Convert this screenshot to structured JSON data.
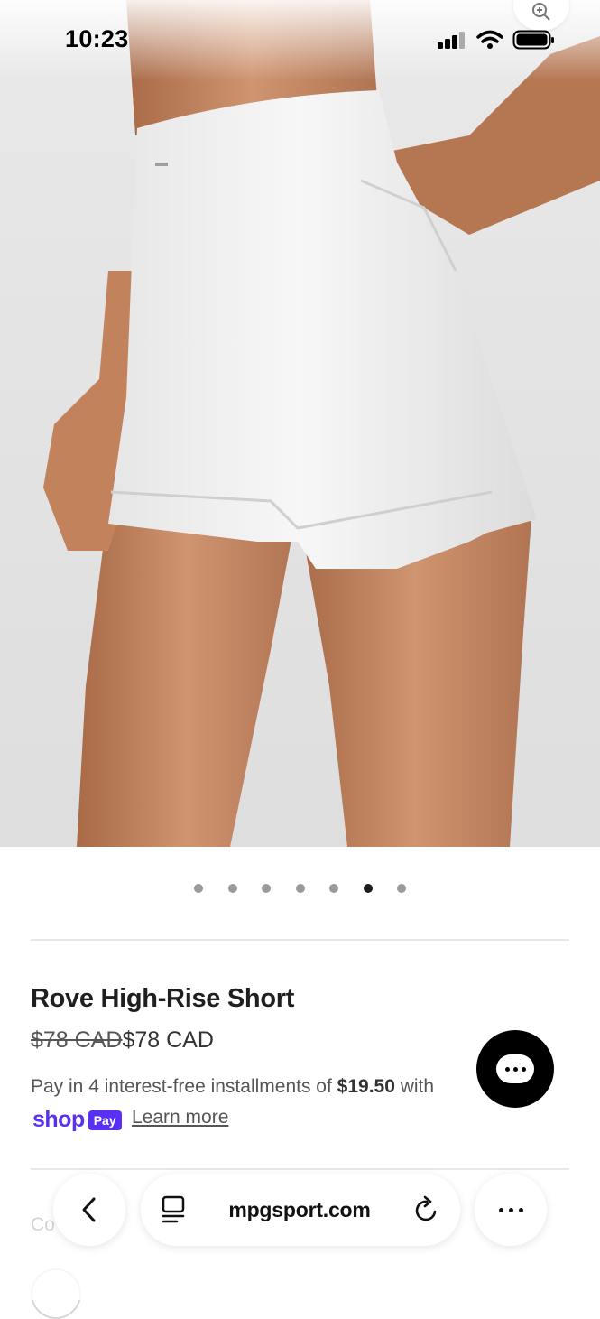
{
  "status_bar": {
    "time": "10:23"
  },
  "carousel": {
    "total": 7,
    "active_index": 5
  },
  "product": {
    "title": "Rove High-Rise Short",
    "compare_price": "$78 CAD",
    "price": "$78 CAD",
    "installments_prefix": "Pay in 4 interest-free installments of ",
    "installments_amount": "$19.50",
    "installments_suffix": " with",
    "shop_pay_brand": "shop",
    "shop_pay_badge": "Pay",
    "learn_more": "Learn more",
    "color_label": "Co"
  },
  "browser": {
    "url": "mpgsport.com"
  },
  "icons": {
    "zoom": "zoom-in-icon",
    "signal": "signal-icon",
    "wifi": "wifi-icon",
    "battery": "battery-icon",
    "chat": "chat-icon",
    "back": "back-icon",
    "reader": "reader-icon",
    "reload": "reload-icon",
    "more": "more-icon"
  },
  "colors": {
    "shop_pay_purple": "#5a31f4",
    "shorts": "#f4f4f4",
    "skin": "#c98a62"
  }
}
